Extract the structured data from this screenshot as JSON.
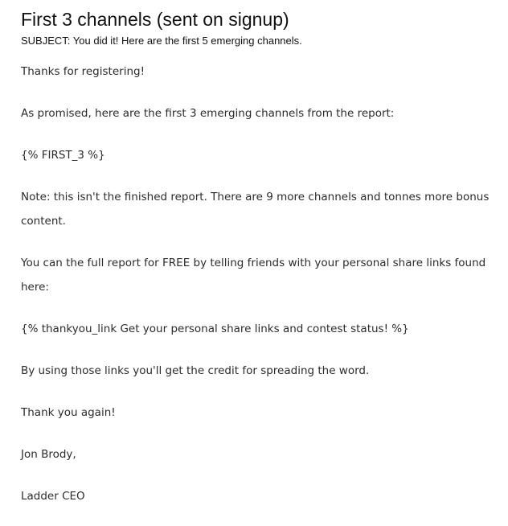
{
  "email": {
    "title": "First 3 channels (sent on signup)",
    "subject_label": "SUBJECT:",
    "subject_text": "You did it! Here are the first 5 emerging channels.",
    "paragraphs": [
      "Thanks for registering!",
      "As promised, here are the first 3 emerging channels from the report:",
      "{% FIRST_3 %}",
      "Note: this isn't the finished report. There are 9 more channels and tonnes more bonus content.",
      "You can the full report for FREE by telling friends with your personal share links found here:",
      "{% thankyou_link Get your personal share links and contest status! %}",
      "By using those links you'll get the credit for spreading the word.",
      "Thank you again!",
      "Jon Brody,",
      "Ladder CEO"
    ]
  }
}
